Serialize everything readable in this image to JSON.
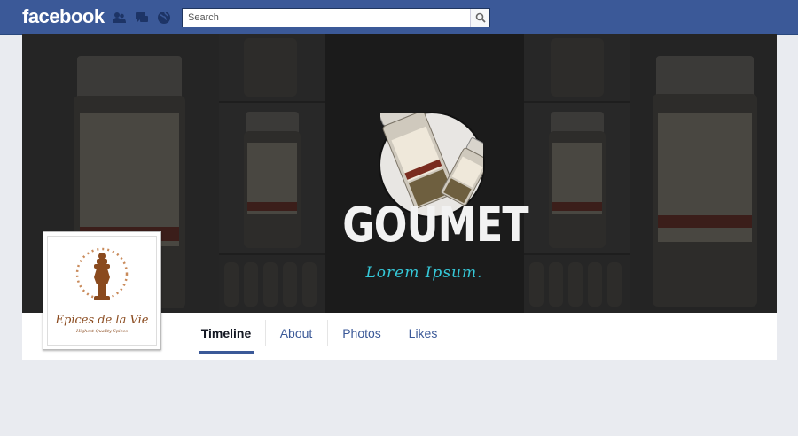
{
  "topbar": {
    "logo": "facebook",
    "jewels": [
      "friend-requests-icon",
      "messages-icon",
      "notifications-globe-icon"
    ],
    "search": {
      "placeholder": "Search",
      "value": ""
    }
  },
  "cover": {
    "headline": "GOUMET",
    "tagline": "Lorem Ipsum."
  },
  "profile": {
    "brand_name": "Epices de la Vie",
    "brand_tagline": "Highest Quality Spices"
  },
  "tabs": [
    {
      "label": "Timeline",
      "active": true
    },
    {
      "label": "About"
    },
    {
      "label": "Photos"
    },
    {
      "label": "Likes"
    }
  ],
  "colors": {
    "fb_blue": "#3b5998",
    "page_bg": "#e9ebf0",
    "tagline_cyan": "#35c8d8",
    "brand_brown": "#8a4a1e"
  }
}
